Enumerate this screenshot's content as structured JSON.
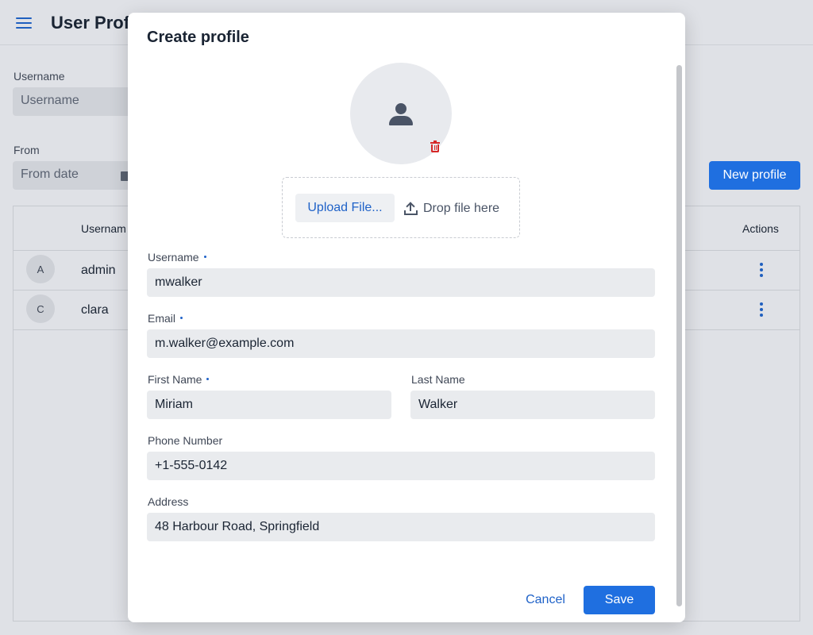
{
  "background": {
    "page_title": "User Profi",
    "filters": {
      "username_label": "Username",
      "username_placeholder": "Username",
      "from_label": "From",
      "from_placeholder": "From date"
    },
    "new_profile_label": "New profile",
    "grid": {
      "columns": {
        "username": "Usernam",
        "actions": "Actions"
      },
      "rows": [
        {
          "initial": "A",
          "username": "admin"
        },
        {
          "initial": "C",
          "username": "clara"
        }
      ]
    }
  },
  "dialog": {
    "title": "Create profile",
    "upload": {
      "button_label": "Upload File...",
      "drop_text": "Drop file here"
    },
    "fields": {
      "username": {
        "label": "Username",
        "value": "mwalker",
        "required": true
      },
      "email": {
        "label": "Email",
        "value": "m.walker@example.com",
        "required": true
      },
      "first_name": {
        "label": "First Name",
        "value": "Miriam",
        "required": true
      },
      "last_name": {
        "label": "Last Name",
        "value": "Walker",
        "required": false
      },
      "phone": {
        "label": "Phone Number",
        "value": "+1-555-0142",
        "required": false
      },
      "address": {
        "label": "Address",
        "value": "48 Harbour Road, Springfield",
        "required": false
      }
    },
    "actions": {
      "cancel_label": "Cancel",
      "save_label": "Save"
    }
  },
  "icons": {
    "menu": "hamburger-menu-icon",
    "calendar": "calendar-icon",
    "avatar_placeholder": "person-icon",
    "delete": "trash-icon",
    "upload": "upload-icon",
    "row_actions": "kebab-menu-icon"
  },
  "colors": {
    "primary": "#1f6fe0",
    "link": "#1f62c8",
    "danger": "#d62828",
    "field_bg": "#e9ebee"
  }
}
